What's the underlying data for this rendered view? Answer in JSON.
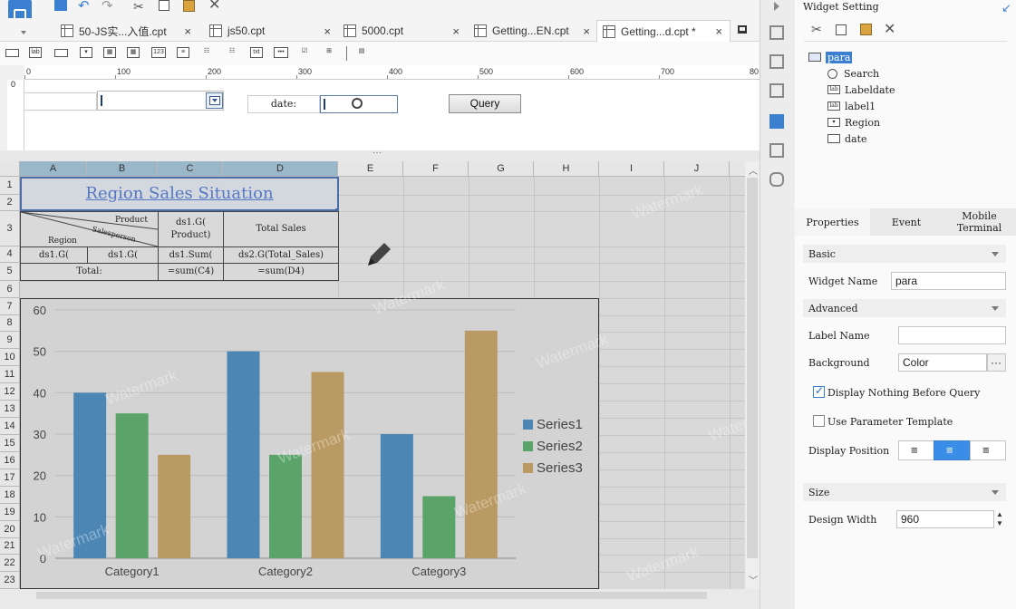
{
  "tabs": [
    {
      "label": "50-JS实...入值.cpt",
      "close": "×",
      "active": false
    },
    {
      "label": "js50.cpt",
      "close": "×",
      "active": false
    },
    {
      "label": "5000.cpt",
      "close": "×",
      "active": false
    },
    {
      "label": "Getting...EN.cpt",
      "close": "×",
      "active": false
    },
    {
      "label": "Getting...d.cpt *",
      "close": "×",
      "active": true
    }
  ],
  "ruler": {
    "ticks": [
      "0",
      "100",
      "200",
      "300",
      "400",
      "500",
      "600",
      "700",
      "80"
    ]
  },
  "form": {
    "date_label": "date:",
    "query_label": "Query"
  },
  "grid": {
    "columns": [
      "A",
      "B",
      "C",
      "D",
      "E",
      "F",
      "G",
      "H",
      "I",
      "J"
    ],
    "rows": [
      "1",
      "2",
      "3",
      "4",
      "5",
      "6",
      "7",
      "8",
      "9",
      "10",
      "11",
      "12",
      "13",
      "14",
      "15",
      "16",
      "17",
      "18",
      "19",
      "20",
      "21",
      "22",
      "23"
    ],
    "title": "Region Sales Situation",
    "header_product": "Product",
    "header_salesperson": "Salesperson",
    "header_region": "Region",
    "c3": "ds1.G( Product)",
    "d3": "Total Sales",
    "a4": "ds1.G(",
    "b4": "ds1.G(",
    "c4": "ds1.Sum(",
    "d4": "ds2.G(Total_Sales)",
    "total_label": "Total:",
    "c5": "=sum(C4)",
    "d5": "=sum(D4)",
    "watermark": "Watermark"
  },
  "chart_data": {
    "type": "bar",
    "categories": [
      "Category1",
      "Category2",
      "Category3"
    ],
    "series": [
      {
        "name": "Series1",
        "values": [
          40,
          50,
          30
        ],
        "color": "#4c86b5"
      },
      {
        "name": "Series2",
        "values": [
          35,
          25,
          15
        ],
        "color": "#5aa46a"
      },
      {
        "name": "Series3",
        "values": [
          25,
          45,
          55
        ],
        "color": "#b99a62"
      }
    ],
    "yticks": [
      "0",
      "10",
      "20",
      "30",
      "40",
      "50",
      "60"
    ],
    "ylim": [
      0,
      60
    ],
    "legend": "right"
  },
  "panel": {
    "title": "Widget Setting",
    "tree": [
      {
        "label": "para",
        "icon": "form-icon",
        "selected": true
      },
      {
        "label": "Search",
        "icon": "search-icon"
      },
      {
        "label": "Labeldate",
        "icon": "label-icon"
      },
      {
        "label": "label1",
        "icon": "label-icon"
      },
      {
        "label": "Region",
        "icon": "dropdown-icon"
      },
      {
        "label": "date",
        "icon": "textbox-icon"
      }
    ],
    "tabs": [
      "Properties",
      "Event",
      "Mobile Terminal"
    ],
    "basic": "Basic",
    "widget_name_label": "Widget Name",
    "widget_name_value": "para",
    "advanced": "Advanced",
    "label_name_label": "Label Name",
    "label_name_value": "",
    "background_label": "Background",
    "background_value": "Color",
    "background_more": "···",
    "display_nothing_label": "Display Nothing Before Query",
    "display_nothing_checked": true,
    "use_template_label": "Use Parameter Template",
    "use_template_checked": false,
    "display_position_label": "Display Position",
    "size": "Size",
    "design_width_label": "Design Width",
    "design_width_value": "960"
  }
}
